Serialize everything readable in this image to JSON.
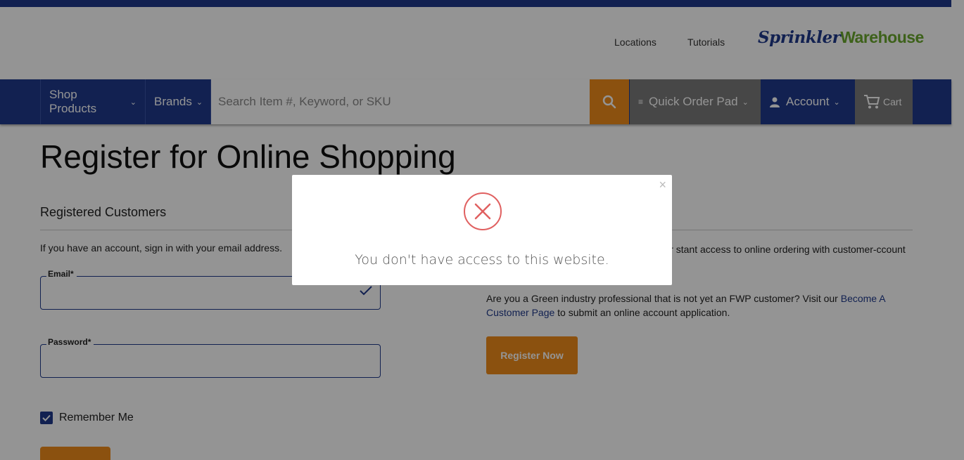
{
  "header": {
    "util_links": [
      "Locations",
      "Tutorials"
    ],
    "logo": {
      "part1": "Sprinkler",
      "part2": "Warehouse"
    }
  },
  "nav": {
    "shop_products": "Shop Products",
    "brands": "Brands",
    "search_placeholder": "Search Item #, Keyword, or SKU",
    "quick_order_pad": "Quick Order Pad",
    "account": "Account",
    "cart": "Cart"
  },
  "page": {
    "title": "Register for Online Shopping",
    "registered_title": "Registered Customers",
    "lead": "If you have an account, sign in with your email address.",
    "email_label": "Email*",
    "password_label": "Password*",
    "remember_me": "Remember Me",
    "right_para1": "ster now to start shopping FWP. Once your stant access to online ordering with customer-ccount management, and many other features!",
    "right_para2_a": "Are you a Green industry professional that is not yet an FWP customer? Visit our ",
    "right_para2_link": "Become A Customer Page",
    "right_para2_b": " to submit an online account application.",
    "register_now": "Register Now"
  },
  "modal": {
    "message": "You don't have access to this website.",
    "close_glyph": "×"
  },
  "colors": {
    "brand_blue": "#1f3a8c",
    "accent_orange": "#f08c1a",
    "logo_green": "#6aa82e",
    "error_red": "#e06060"
  }
}
